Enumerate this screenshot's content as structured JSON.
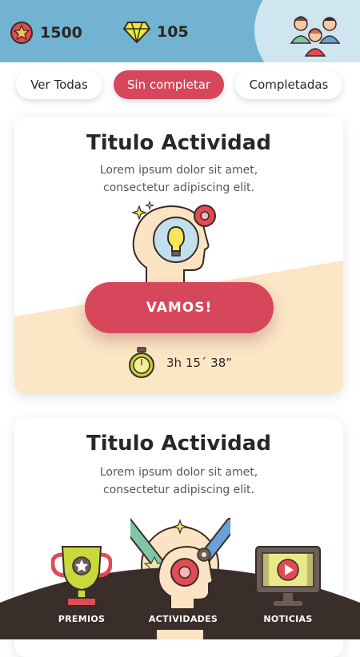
{
  "header": {
    "coins": "1500",
    "gems": "105",
    "icons": [
      "star-coin-icon",
      "gem-icon",
      "family-avatar-icon"
    ],
    "colors": {
      "bar": "#72b3d1",
      "circle": "#cfe5f0"
    }
  },
  "filters": [
    {
      "label": "Ver Todas",
      "active": false
    },
    {
      "label": "Sin completar",
      "active": true
    },
    {
      "label": "Completadas",
      "active": false
    }
  ],
  "cards": [
    {
      "title": "Titulo Actividad",
      "desc1": "Lorem ipsum dolor sit amet,",
      "desc2": "consectetur adipiscing elit.",
      "button": "VAMOS!",
      "timer": "3h 15´ 38”",
      "icon": "idea-head-icon"
    },
    {
      "title": "Titulo Actividad",
      "desc1": "Lorem ipsum dolor sit amet,",
      "desc2": "consectetur adipiscing elit.",
      "icon": "pencils-creativity-icon"
    }
  ],
  "nav": [
    {
      "label": "PREMIOS",
      "icon": "trophy-icon"
    },
    {
      "label": "ACTIVIDADES",
      "icon": "brain-gear-icon"
    },
    {
      "label": "NOTICIAS",
      "icon": "video-screen-icon"
    }
  ],
  "colors": {
    "accent": "#d6475c",
    "cream": "#fbe6c6",
    "nav": "#3a2e2b"
  }
}
